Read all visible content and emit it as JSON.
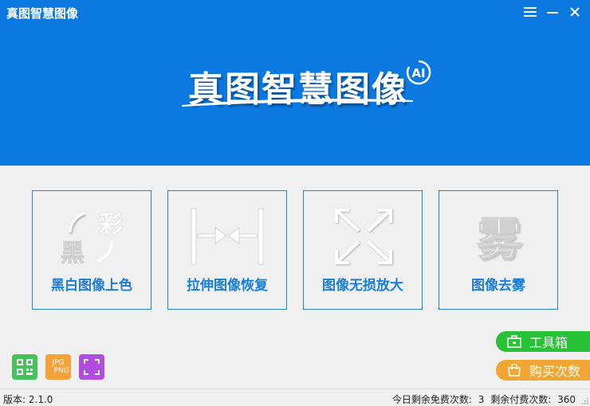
{
  "window": {
    "title": "真图智慧图像",
    "controls": [
      "menu-icon",
      "minimize-icon",
      "close-icon"
    ]
  },
  "logo": {
    "text": "真图智慧图像",
    "badge": "AI"
  },
  "cards": [
    {
      "label": "黑白图像上色",
      "icon": "colorize-icon",
      "glyph_a": "彩",
      "glyph_b": "黑"
    },
    {
      "label": "拉伸图像恢复",
      "icon": "stretch-restore-icon"
    },
    {
      "label": "图像无损放大",
      "icon": "enlarge-icon"
    },
    {
      "label": "图像去雾",
      "icon": "dehaze-icon",
      "glyph": "雾"
    }
  ],
  "tools": {
    "jpg_label": "JPG",
    "png_label": "PNG"
  },
  "side_buttons": {
    "toolbox": "工具箱",
    "buy": "购买次数"
  },
  "status": {
    "version_label": "版本:",
    "version": "2.1.0",
    "free_label": "今日剩余免费次数:",
    "free_count": "3",
    "paid_label": "剩余付费次数:",
    "paid_count": "360"
  },
  "colors": {
    "header": "#0b79e0",
    "card_border": "#1f82d8",
    "card_text": "#1a7fd6",
    "toolbox": "#28c236",
    "buy": "#f0a632"
  }
}
